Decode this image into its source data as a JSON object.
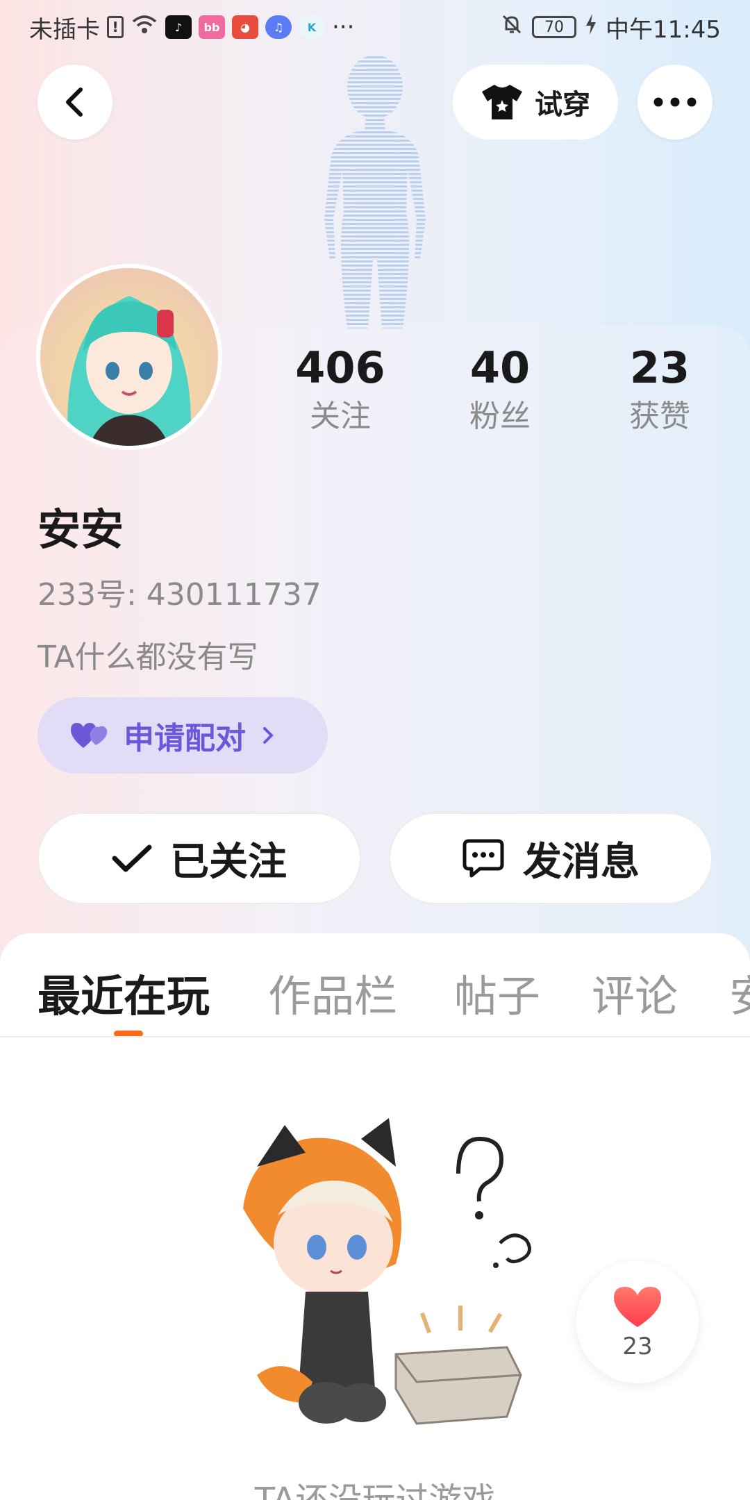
{
  "status_bar": {
    "carrier": "未插卡",
    "time": "中午11:45",
    "battery": "70",
    "more": "···"
  },
  "header": {
    "tryon_label": "试穿"
  },
  "profile": {
    "stats": [
      {
        "value": "406",
        "label": "关注"
      },
      {
        "value": "40",
        "label": "粉丝"
      },
      {
        "value": "23",
        "label": "获赞"
      }
    ],
    "name": "安安",
    "uid": "233号:  430111737",
    "bio": "TA什么都没有写",
    "pair_label": "申请配对",
    "follow_label": "已关注",
    "message_label": "发消息"
  },
  "tabs": [
    {
      "label": "最近在玩",
      "active": true
    },
    {
      "label": "作品栏",
      "active": false
    },
    {
      "label": "帖子",
      "active": false
    },
    {
      "label": "评论",
      "active": false
    },
    {
      "label": "安",
      "active": false
    }
  ],
  "empty_state": {
    "text": "TA还没玩过游戏"
  },
  "like_fab": {
    "count": "23"
  },
  "colors": {
    "accent_purple": "#6b58d8",
    "tab_indicator": "#ff6a1a",
    "heart": "#ff4b4b"
  }
}
